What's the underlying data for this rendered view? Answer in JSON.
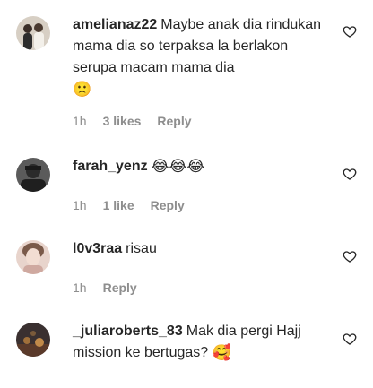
{
  "comments": [
    {
      "username": "amelianaz22",
      "text": "Maybe anak dia rindukan mama dia so terpaksa la berlakon serupa macam mama dia",
      "emoji": "🙁",
      "time": "1h",
      "likes": "3 likes",
      "reply": "Reply",
      "avatar_colors": [
        "#d7cfc4",
        "#2d2d2d"
      ]
    },
    {
      "username": "farah_yenz",
      "text": "",
      "emoji": "😂😂😂",
      "time": "1h",
      "likes": "1 like",
      "reply": "Reply",
      "avatar_colors": [
        "#5b5b5b",
        "#1f1f1f"
      ]
    },
    {
      "username": "l0v3raa",
      "text": "risau",
      "emoji": "",
      "time": "1h",
      "likes": "",
      "reply": "Reply",
      "avatar_colors": [
        "#e8d4cc",
        "#7a5a4a"
      ]
    },
    {
      "username": "_juliaroberts_83",
      "text": "Mak dia pergi Hajj mission ke bertugas?",
      "emoji": "🥰",
      "time": "",
      "likes": "",
      "reply": "",
      "avatar_colors": [
        "#3a3030",
        "#a0703a"
      ]
    }
  ],
  "icons": {
    "like": "heart-outline-icon"
  },
  "colors": {
    "text": "#262626",
    "meta": "#8e8e8e",
    "background": "#ffffff"
  }
}
